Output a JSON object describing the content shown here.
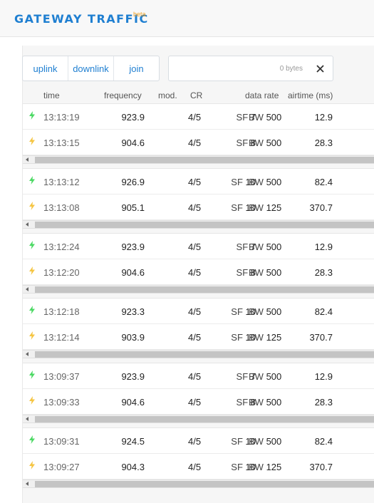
{
  "header": {
    "title": "GATEWAY TRAFFIC",
    "badge": "beta"
  },
  "tabs": [
    {
      "label": "uplink"
    },
    {
      "label": "downlink"
    },
    {
      "label": "join"
    }
  ],
  "filter": {
    "bytes_label": "0 bytes",
    "clear_icon": "close-icon"
  },
  "columns": {
    "time": "time",
    "frequency": "frequency",
    "mod": "mod.",
    "cr": "CR",
    "data_rate": "data rate",
    "airtime": "airtime (ms)"
  },
  "colors": {
    "accent": "#1f7fd1",
    "uplink_bolt": "#4cd964",
    "downlink_bolt": "#f5c542"
  },
  "groups": [
    {
      "rows": [
        {
          "direction": "uplink",
          "time": "13:13:19",
          "frequency": "923.9",
          "cr": "4/5",
          "sf": "7",
          "bw": "500",
          "airtime": "12.9"
        },
        {
          "direction": "downlink",
          "time": "13:13:15",
          "frequency": "904.6",
          "cr": "4/5",
          "sf": "8",
          "bw": "500",
          "airtime": "28.3"
        }
      ]
    },
    {
      "rows": [
        {
          "direction": "uplink",
          "time": "13:13:12",
          "frequency": "926.9",
          "cr": "4/5",
          "sf": "10",
          "bw": "500",
          "airtime": "82.4"
        },
        {
          "direction": "downlink",
          "time": "13:13:08",
          "frequency": "905.1",
          "cr": "4/5",
          "sf": "10",
          "bw": "125",
          "airtime": "370.7"
        }
      ]
    },
    {
      "rows": [
        {
          "direction": "uplink",
          "time": "13:12:24",
          "frequency": "923.9",
          "cr": "4/5",
          "sf": "7",
          "bw": "500",
          "airtime": "12.9"
        },
        {
          "direction": "downlink",
          "time": "13:12:20",
          "frequency": "904.6",
          "cr": "4/5",
          "sf": "8",
          "bw": "500",
          "airtime": "28.3"
        }
      ]
    },
    {
      "rows": [
        {
          "direction": "uplink",
          "time": "13:12:18",
          "frequency": "923.3",
          "cr": "4/5",
          "sf": "10",
          "bw": "500",
          "airtime": "82.4"
        },
        {
          "direction": "downlink",
          "time": "13:12:14",
          "frequency": "903.9",
          "cr": "4/5",
          "sf": "10",
          "bw": "125",
          "airtime": "370.7"
        }
      ]
    },
    {
      "rows": [
        {
          "direction": "uplink",
          "time": "13:09:37",
          "frequency": "923.9",
          "cr": "4/5",
          "sf": "7",
          "bw": "500",
          "airtime": "12.9"
        },
        {
          "direction": "downlink",
          "time": "13:09:33",
          "frequency": "904.6",
          "cr": "4/5",
          "sf": "8",
          "bw": "500",
          "airtime": "28.3"
        }
      ]
    },
    {
      "rows": [
        {
          "direction": "uplink",
          "time": "13:09:31",
          "frequency": "924.5",
          "cr": "4/5",
          "sf": "10",
          "bw": "500",
          "airtime": "82.4"
        },
        {
          "direction": "downlink",
          "time": "13:09:27",
          "frequency": "904.3",
          "cr": "4/5",
          "sf": "10",
          "bw": "125",
          "airtime": "370.7"
        }
      ]
    }
  ]
}
